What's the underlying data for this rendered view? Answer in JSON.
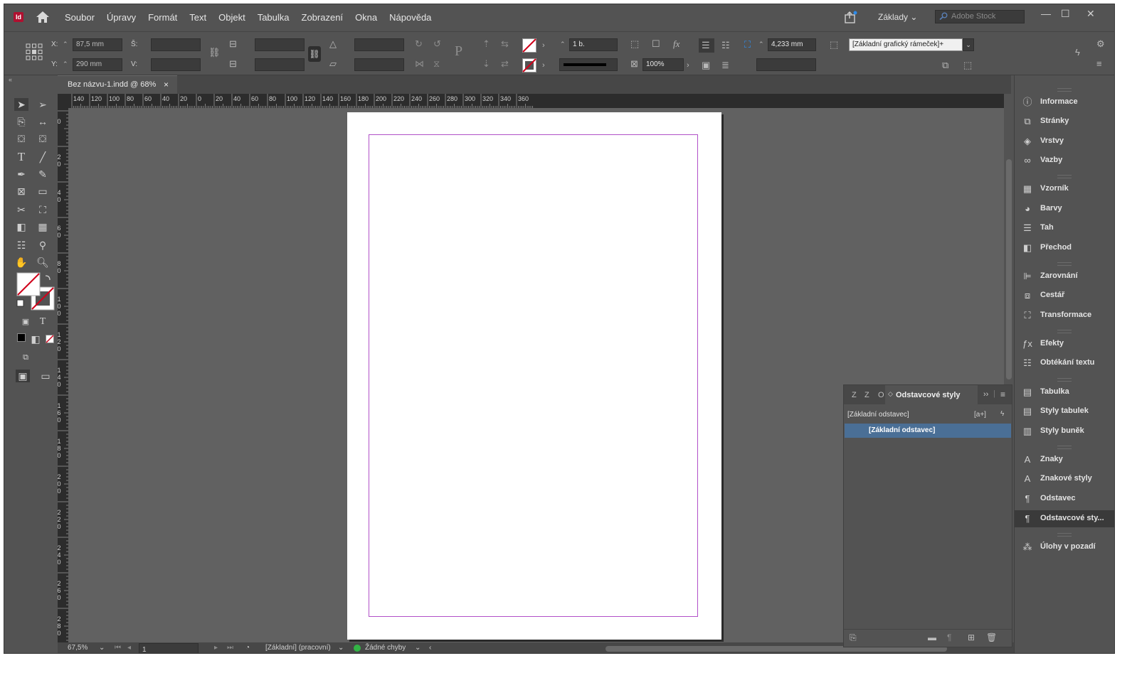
{
  "app": {
    "logo": "Id"
  },
  "menu": [
    "Soubor",
    "Úpravy",
    "Formát",
    "Text",
    "Objekt",
    "Tabulka",
    "Zobrazení",
    "Okna",
    "Nápověda"
  ],
  "workspace": "Základy",
  "search": {
    "placeholder": "Adobe Stock"
  },
  "control": {
    "x_label": "X:",
    "x_value": "87,5 mm",
    "y_label": "Y:",
    "y_value": "290 mm",
    "w_label": "Š:",
    "h_label": "V:",
    "stroke_weight": "1 b.",
    "opacity": "100%",
    "gap": "4,233 mm",
    "object_style": "[Základní grafický rámeček]+"
  },
  "tab": {
    "title": "Bez názvu-1.indd @ 68%",
    "close": "×"
  },
  "hruler_labels": [
    "140",
    "120",
    "100",
    "80",
    "60",
    "40",
    "20",
    "0",
    "20",
    "40",
    "60",
    "80",
    "100",
    "120",
    "140",
    "160",
    "180",
    "200",
    "220",
    "240",
    "260",
    "280",
    "300",
    "320",
    "340",
    "360"
  ],
  "vruler_labels": [
    "0",
    "20",
    "40",
    "60",
    "80",
    "100",
    "120",
    "140",
    "160",
    "180",
    "200",
    "220",
    "240",
    "260",
    "280"
  ],
  "status": {
    "zoom": "67,5%",
    "page": "1",
    "profile": "[Základní] (pracovní)",
    "errors": "Žádné chyby"
  },
  "panels": [
    {
      "icon": "info-icon",
      "label": "Informace"
    },
    {
      "icon": "pages-icon",
      "label": "Stránky"
    },
    {
      "icon": "layers-icon",
      "label": "Vrstvy"
    },
    {
      "icon": "links-icon",
      "label": "Vazby"
    },
    {
      "icon": "swatches-icon",
      "label": "Vzorník"
    },
    {
      "icon": "color-icon",
      "label": "Barvy"
    },
    {
      "icon": "stroke-icon",
      "label": "Tah"
    },
    {
      "icon": "gradient-icon",
      "label": "Přechod"
    },
    {
      "icon": "align-icon",
      "label": "Zarovnání"
    },
    {
      "icon": "pathfinder-icon",
      "label": "Cestář"
    },
    {
      "icon": "transform-icon",
      "label": "Transformace"
    },
    {
      "icon": "effects-icon",
      "label": "Efekty"
    },
    {
      "icon": "text-wrap-icon",
      "label": "Obtékání textu"
    },
    {
      "icon": "table-icon",
      "label": "Tabulka"
    },
    {
      "icon": "table-styles-icon",
      "label": "Styly tabulek"
    },
    {
      "icon": "cell-styles-icon",
      "label": "Styly buněk"
    },
    {
      "icon": "character-icon",
      "label": "Znaky"
    },
    {
      "icon": "character-styles-icon",
      "label": "Znakové styly"
    },
    {
      "icon": "paragraph-icon",
      "label": "Odstavec"
    },
    {
      "icon": "paragraph-styles-icon",
      "label": "Odstavcové sty..."
    },
    {
      "icon": "background-tasks-icon",
      "label": "Úlohy v pozadí"
    }
  ],
  "style_panel": {
    "tabs": [
      "Z",
      "Z",
      "O"
    ],
    "title": "Odstavcové styly",
    "current": "[Základní odstavec]",
    "items": [
      "[Základní odstavec]"
    ]
  }
}
